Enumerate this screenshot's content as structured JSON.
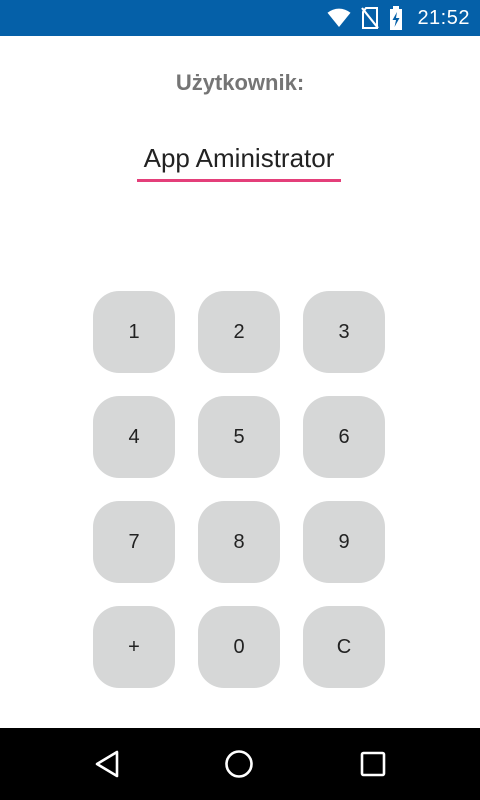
{
  "status_bar": {
    "time": "21:52",
    "icons": [
      "wifi-icon",
      "no-sim-icon",
      "battery-charging-icon"
    ]
  },
  "user_section": {
    "label": "Użytkownik:",
    "value": "App Aministrator"
  },
  "keypad": {
    "keys": [
      "1",
      "2",
      "3",
      "4",
      "5",
      "6",
      "7",
      "8",
      "9",
      "+",
      "0",
      "C"
    ]
  },
  "nav_bar": {
    "buttons": [
      "back-icon",
      "home-icon",
      "recents-icon"
    ]
  },
  "colors": {
    "status_bar_bg": "#0560a8",
    "accent_underline": "#e43f7a",
    "key_bg": "#d6d7d7",
    "label_text": "#757575",
    "nav_bar_bg": "#000000"
  }
}
